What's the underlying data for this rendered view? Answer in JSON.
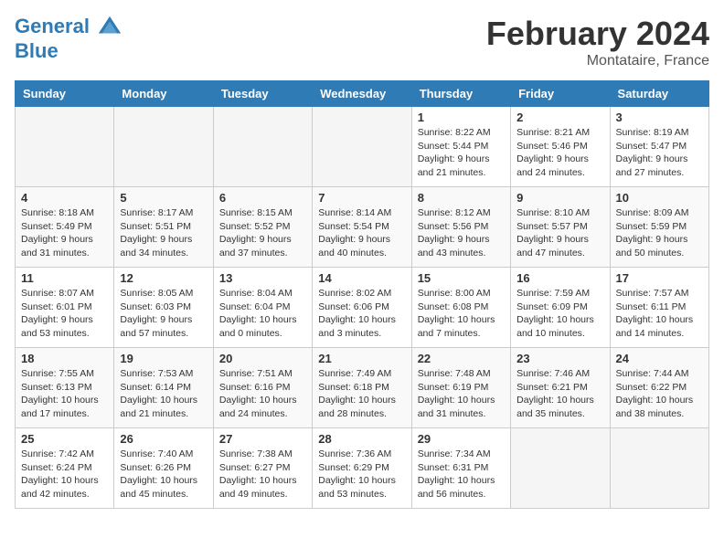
{
  "header": {
    "logo_line1": "General",
    "logo_line2": "Blue",
    "month": "February 2024",
    "location": "Montataire, France"
  },
  "days_of_week": [
    "Sunday",
    "Monday",
    "Tuesday",
    "Wednesday",
    "Thursday",
    "Friday",
    "Saturday"
  ],
  "weeks": [
    [
      {
        "day": "",
        "info": ""
      },
      {
        "day": "",
        "info": ""
      },
      {
        "day": "",
        "info": ""
      },
      {
        "day": "",
        "info": ""
      },
      {
        "day": "1",
        "info": "Sunrise: 8:22 AM\nSunset: 5:44 PM\nDaylight: 9 hours and 21 minutes."
      },
      {
        "day": "2",
        "info": "Sunrise: 8:21 AM\nSunset: 5:46 PM\nDaylight: 9 hours and 24 minutes."
      },
      {
        "day": "3",
        "info": "Sunrise: 8:19 AM\nSunset: 5:47 PM\nDaylight: 9 hours and 27 minutes."
      }
    ],
    [
      {
        "day": "4",
        "info": "Sunrise: 8:18 AM\nSunset: 5:49 PM\nDaylight: 9 hours and 31 minutes."
      },
      {
        "day": "5",
        "info": "Sunrise: 8:17 AM\nSunset: 5:51 PM\nDaylight: 9 hours and 34 minutes."
      },
      {
        "day": "6",
        "info": "Sunrise: 8:15 AM\nSunset: 5:52 PM\nDaylight: 9 hours and 37 minutes."
      },
      {
        "day": "7",
        "info": "Sunrise: 8:14 AM\nSunset: 5:54 PM\nDaylight: 9 hours and 40 minutes."
      },
      {
        "day": "8",
        "info": "Sunrise: 8:12 AM\nSunset: 5:56 PM\nDaylight: 9 hours and 43 minutes."
      },
      {
        "day": "9",
        "info": "Sunrise: 8:10 AM\nSunset: 5:57 PM\nDaylight: 9 hours and 47 minutes."
      },
      {
        "day": "10",
        "info": "Sunrise: 8:09 AM\nSunset: 5:59 PM\nDaylight: 9 hours and 50 minutes."
      }
    ],
    [
      {
        "day": "11",
        "info": "Sunrise: 8:07 AM\nSunset: 6:01 PM\nDaylight: 9 hours and 53 minutes."
      },
      {
        "day": "12",
        "info": "Sunrise: 8:05 AM\nSunset: 6:03 PM\nDaylight: 9 hours and 57 minutes."
      },
      {
        "day": "13",
        "info": "Sunrise: 8:04 AM\nSunset: 6:04 PM\nDaylight: 10 hours and 0 minutes."
      },
      {
        "day": "14",
        "info": "Sunrise: 8:02 AM\nSunset: 6:06 PM\nDaylight: 10 hours and 3 minutes."
      },
      {
        "day": "15",
        "info": "Sunrise: 8:00 AM\nSunset: 6:08 PM\nDaylight: 10 hours and 7 minutes."
      },
      {
        "day": "16",
        "info": "Sunrise: 7:59 AM\nSunset: 6:09 PM\nDaylight: 10 hours and 10 minutes."
      },
      {
        "day": "17",
        "info": "Sunrise: 7:57 AM\nSunset: 6:11 PM\nDaylight: 10 hours and 14 minutes."
      }
    ],
    [
      {
        "day": "18",
        "info": "Sunrise: 7:55 AM\nSunset: 6:13 PM\nDaylight: 10 hours and 17 minutes."
      },
      {
        "day": "19",
        "info": "Sunrise: 7:53 AM\nSunset: 6:14 PM\nDaylight: 10 hours and 21 minutes."
      },
      {
        "day": "20",
        "info": "Sunrise: 7:51 AM\nSunset: 6:16 PM\nDaylight: 10 hours and 24 minutes."
      },
      {
        "day": "21",
        "info": "Sunrise: 7:49 AM\nSunset: 6:18 PM\nDaylight: 10 hours and 28 minutes."
      },
      {
        "day": "22",
        "info": "Sunrise: 7:48 AM\nSunset: 6:19 PM\nDaylight: 10 hours and 31 minutes."
      },
      {
        "day": "23",
        "info": "Sunrise: 7:46 AM\nSunset: 6:21 PM\nDaylight: 10 hours and 35 minutes."
      },
      {
        "day": "24",
        "info": "Sunrise: 7:44 AM\nSunset: 6:22 PM\nDaylight: 10 hours and 38 minutes."
      }
    ],
    [
      {
        "day": "25",
        "info": "Sunrise: 7:42 AM\nSunset: 6:24 PM\nDaylight: 10 hours and 42 minutes."
      },
      {
        "day": "26",
        "info": "Sunrise: 7:40 AM\nSunset: 6:26 PM\nDaylight: 10 hours and 45 minutes."
      },
      {
        "day": "27",
        "info": "Sunrise: 7:38 AM\nSunset: 6:27 PM\nDaylight: 10 hours and 49 minutes."
      },
      {
        "day": "28",
        "info": "Sunrise: 7:36 AM\nSunset: 6:29 PM\nDaylight: 10 hours and 53 minutes."
      },
      {
        "day": "29",
        "info": "Sunrise: 7:34 AM\nSunset: 6:31 PM\nDaylight: 10 hours and 56 minutes."
      },
      {
        "day": "",
        "info": ""
      },
      {
        "day": "",
        "info": ""
      }
    ]
  ]
}
